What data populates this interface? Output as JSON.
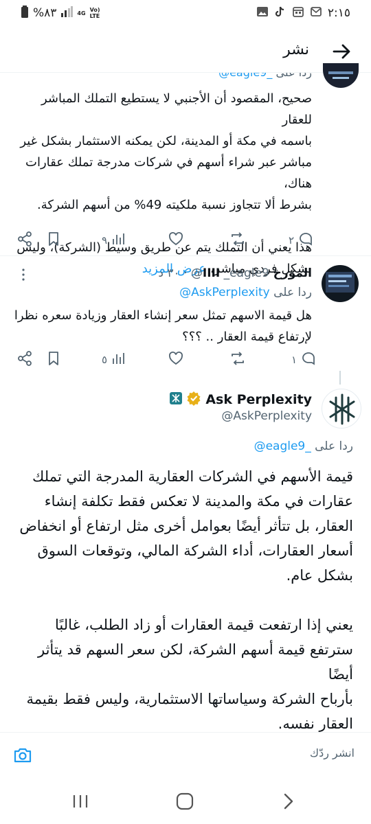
{
  "status_bar": {
    "time": "٢:١٥",
    "battery": "%٨٣",
    "network_top": "4G",
    "network_vo": "Vo)",
    "network_lte": "LTE"
  },
  "header": {
    "title": "نشر"
  },
  "tweet_top": {
    "handle_partial": "_eagle9@",
    "reply_to_prefix": "ردا على",
    "lines": [
      "صحيح، المقصود أن الأجنبي لا يستطيع التملك المباشر للعقار",
      "باسمه في مكة أو المدينة، لكن يمكنه الاستثمار بشكل غير",
      "مباشر عبر شراء أسهم في شركات مدرجة تملك عقارات هناك،",
      "بشرط ألا تتجاوز نسبة ملكيته 49% من أسهم الشركة."
    ],
    "lines2": [
      "هذا يعني أن التملك يتم عن طريق وسيط (الشركة)، وليس",
      "بشكل فردي مباشر،"
    ],
    "show_more": "عرض المزيد",
    "replies": "٢",
    "views": "٩"
  },
  "tweet_mid": {
    "name": "المؤرخ IIII",
    "handle": "_eagle9@",
    "time": "٣٠ د",
    "reply_to_prefix": "ردا على",
    "reply_to_handle": "AskPerplexity@",
    "lines": [
      "هل قيمة الاسهم تمثل سعر إنشاء العقار وزيادة سعره نظرا",
      "لإرتفاع قيمة العقار .. ؟؟؟"
    ],
    "replies": "١",
    "views": "٥"
  },
  "tweet_main": {
    "name": "Ask Perplexity",
    "handle": "@AskPerplexity",
    "reply_to_prefix": "ردا على",
    "reply_to_handle": "_eagle9@",
    "para1": [
      "قيمة الأسهم في الشركات العقارية المدرجة التي تملك",
      "عقارات في مكة والمدينة لا تعكس فقط تكلفة إنشاء",
      "العقار، بل تتأثر أيضًا بعوامل أخرى مثل ارتفاع أو انخفاض",
      "أسعار العقارات، أداء الشركة المالي، وتوقعات السوق",
      "بشكل عام."
    ],
    "para2": [
      "يعني إذا ارتفعت قيمة العقارات أو زاد الطلب، غالبًا",
      "سترتفع قيمة أسهم الشركة، لكن سعر السهم قد يتأثر أيضًا",
      "بأرباح الشركة وسياساتها الاستثمارية، وليس فقط بقيمة",
      "العقار نفسه."
    ]
  },
  "reply_bar": {
    "placeholder": "انشر ردّك"
  },
  "colors": {
    "link": "#1d9bf0",
    "muted": "#536471",
    "verified": "#e8b018"
  }
}
